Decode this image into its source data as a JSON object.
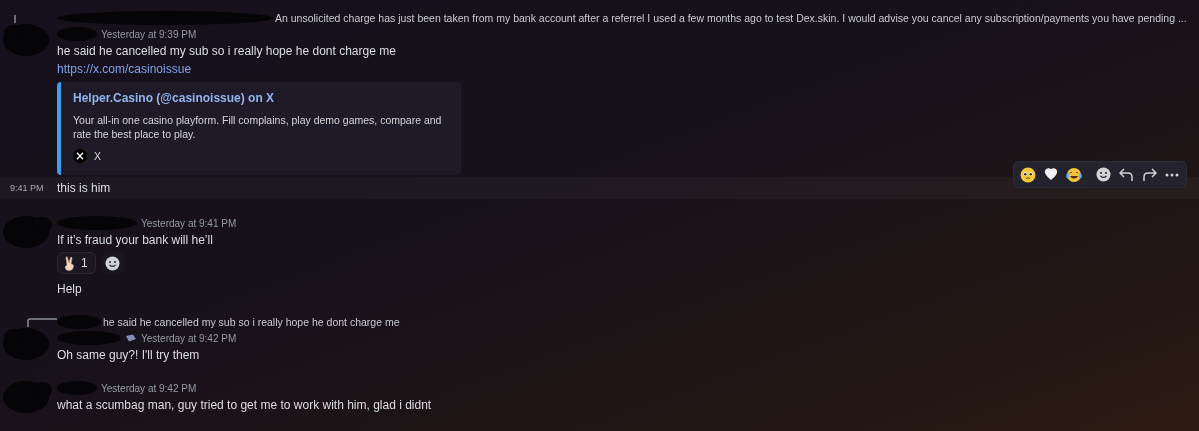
{
  "messages": [
    {
      "kind": "group",
      "reply": {
        "text": "An unsolicited charge has just been taken from my bank account after a referrel I used a few months ago to test Dex.skin. I would advise you cancel any subscription/payments you have pending ..."
      },
      "badge": false,
      "timestamp": "Yesterday at 9:39 PM",
      "lines": [
        {
          "kind": "text",
          "text": "he said he cancelled my sub so i really hope he dont charge me"
        },
        {
          "kind": "link",
          "text": "https://x.com/casinoissue"
        }
      ],
      "embed": {
        "title": "Helper.Casino (@casinoissue) on X",
        "description": "Your all-in one casino playform. Fill complains, play demo games, compare and rate the best place to play.",
        "provider": "X"
      }
    },
    {
      "kind": "compact",
      "time": "9:41 PM",
      "text": "this is him",
      "hovered": true
    },
    {
      "kind": "group",
      "badge": false,
      "timestamp": "Yesterday at 9:41 PM",
      "lines": [
        {
          "kind": "text",
          "text": "If it’s fraud your bank will he’ll"
        },
        {
          "kind": "reactions",
          "reactions": [
            {
              "count": "1",
              "selected": false
            }
          ]
        },
        {
          "kind": "text",
          "text": "Help"
        }
      ]
    },
    {
      "kind": "group",
      "reply": {
        "text": "he said he cancelled my sub so i really hope he dont charge me"
      },
      "badge": true,
      "timestamp": "Yesterday at 9:42 PM",
      "lines": [
        {
          "kind": "text",
          "text": "Oh same guy?! I'll try them"
        }
      ]
    },
    {
      "kind": "group",
      "badge": false,
      "timestamp": "Yesterday at 9:42 PM",
      "lines": [
        {
          "kind": "text",
          "text": "what a scumbag man, guy tried to get me to work with him, glad i didnt"
        }
      ]
    }
  ]
}
